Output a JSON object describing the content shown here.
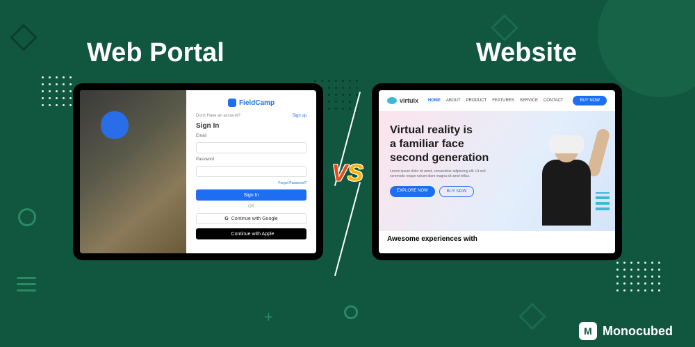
{
  "headings": {
    "left": "Web Portal",
    "right": "Website"
  },
  "vs": {
    "v": "V",
    "s": "S"
  },
  "portal": {
    "logo": "FieldCamp",
    "no_account": "Don't Have an account?",
    "signup": "Sign up",
    "signin_title": "Sign In",
    "email_label": "Email",
    "password_label": "Password",
    "forgot": "Forgot Password?",
    "signin_btn": "Sign In",
    "or": "OR",
    "google_btn": "Continue with Google",
    "apple_btn": "Continue with Apple"
  },
  "site": {
    "logo": "virtulx",
    "nav": [
      "HOME",
      "ABOUT",
      "PRODUCT",
      "FEATURES",
      "SERVICE",
      "CONTACT"
    ],
    "nav_btn": "BUY NOW",
    "hero_line1": "Virtual reality is",
    "hero_line2": "a familiar face",
    "hero_line3": "second generation",
    "hero_sub": "Lorem ipsum dolor sit amet, consectetur adipiscing elit. Ut sed commodo neque rutrum diam magna sit amet tellus.",
    "btn1": "EXPLORE NOW",
    "btn2": "BUY NOW",
    "footer": "Awesome experiences with"
  },
  "brand": "Monocubed"
}
